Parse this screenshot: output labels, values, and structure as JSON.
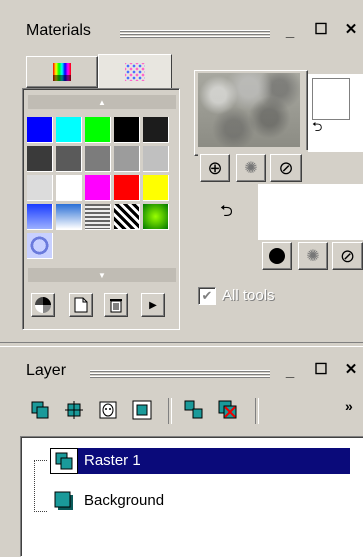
{
  "materials": {
    "title": "Materials",
    "tabs": [
      {
        "id": "tab-color-picker",
        "icon": "spectrum-icon",
        "active": false
      },
      {
        "id": "tab-swatches",
        "icon": "swatches-icon",
        "active": true
      }
    ],
    "swatch_rows": [
      [
        "#0000ff",
        "#00ffff",
        "#00ff00",
        "#000000",
        "#1c1c1c"
      ],
      [
        "#3a3a3a",
        "#5a5a5a",
        "#7c7c7c",
        "#9c9c9c",
        "#c0c0c0"
      ],
      [
        "#dcdcdc",
        "#ffffff",
        "#ff00ff",
        "#ff0000",
        "#ffff00"
      ],
      [
        "gradient-blue",
        "gradient-sky",
        "pattern-stripes",
        "pattern-zebra",
        "gradient-green"
      ],
      [
        "pattern-circles"
      ]
    ],
    "bottom_tools": [
      "swatch-options-icon",
      "new-swatch-icon",
      "delete-swatch-icon",
      "more-arrow-icon"
    ],
    "all_tools_label": "All tools",
    "all_tools_checked": true
  },
  "layer": {
    "title": "Layer",
    "toolbar": [
      "new-raster-layer-icon",
      "new-vector-layer-icon",
      "new-mask-icon",
      "new-adjustment-layer-icon",
      "duplicate-layer-icon",
      "delete-layer-icon"
    ],
    "overflow": "»",
    "rows": [
      {
        "name": "Raster 1",
        "selected": true
      },
      {
        "name": "Background",
        "selected": false
      }
    ]
  },
  "colors": {
    "selection": "#0a0a7a",
    "panel": "#d4d0c8",
    "layer_icon": "#1a9a9a"
  }
}
